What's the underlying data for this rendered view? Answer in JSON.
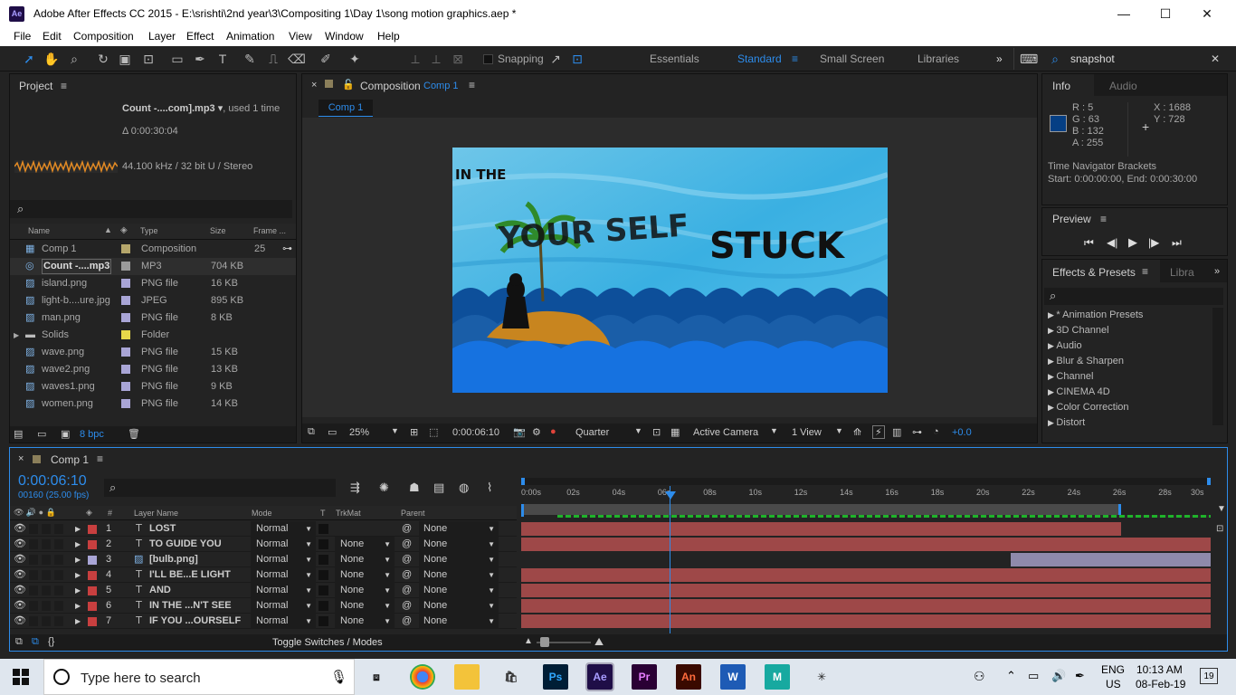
{
  "window": {
    "title": "Adobe After Effects CC 2015 - E:\\srishti\\2nd year\\3\\Compositing 1\\Day 1\\song motion graphics.aep *",
    "logo": "Ae",
    "min": "—",
    "max": "☐",
    "close": "✕"
  },
  "menu": [
    "File",
    "Edit",
    "Composition",
    "Layer",
    "Effect",
    "Animation",
    "View",
    "Window",
    "Help"
  ],
  "toolbar": {
    "snapping": "Snapping",
    "workspaces": [
      "Essentials",
      "Standard",
      "Small Screen",
      "Libraries"
    ],
    "active_workspace": "Standard",
    "search_value": "snapshot",
    "more": "»"
  },
  "project": {
    "title": "Project",
    "selected_name": "Count -....com].mp3 ▾",
    "used": ", used 1 time",
    "duration": "Δ 0:00:30:04",
    "audio_info": "44.100 kHz / 32 bit U / Stereo",
    "columns": [
      "Name",
      "Type",
      "Size",
      "Frame ..."
    ],
    "items": [
      {
        "name": "Comp 1",
        "type": "Composition",
        "size": "",
        "frame": "25",
        "color": "#b5a66b",
        "icon": "comp"
      },
      {
        "name": "Count -....mp3",
        "type": "MP3",
        "size": "704 KB",
        "frame": "",
        "color": "#9a9a9a",
        "icon": "audio"
      },
      {
        "name": "island.png",
        "type": "PNG file",
        "size": "16 KB",
        "frame": "",
        "color": "#a9a5d6",
        "icon": "image"
      },
      {
        "name": "light-b....ure.jpg",
        "type": "JPEG",
        "size": "895 KB",
        "frame": "",
        "color": "#a9a5d6",
        "icon": "image"
      },
      {
        "name": "man.png",
        "type": "PNG file",
        "size": "8 KB",
        "frame": "",
        "color": "#a9a5d6",
        "icon": "image"
      },
      {
        "name": "Solids",
        "type": "Folder",
        "size": "",
        "frame": "",
        "color": "#e6d84a",
        "icon": "folder"
      },
      {
        "name": "wave.png",
        "type": "PNG file",
        "size": "15 KB",
        "frame": "",
        "color": "#a9a5d6",
        "icon": "image"
      },
      {
        "name": "wave2.png",
        "type": "PNG file",
        "size": "13 KB",
        "frame": "",
        "color": "#a9a5d6",
        "icon": "image"
      },
      {
        "name": "waves1.png",
        "type": "PNG file",
        "size": "9 KB",
        "frame": "",
        "color": "#a9a5d6",
        "icon": "image"
      },
      {
        "name": "women.png",
        "type": "PNG file",
        "size": "14 KB",
        "frame": "",
        "color": "#a9a5d6",
        "icon": "image"
      }
    ],
    "bpc": "8 bpc"
  },
  "composition": {
    "label": "Composition",
    "name": "Comp 1",
    "tab": "Comp 1",
    "text1": "IN THE",
    "text2": "YOUR SELF",
    "text3": "STUCK",
    "zoom": "25%",
    "timecode": "0:00:06:10",
    "resolution": "Quarter",
    "camera": "Active Camera",
    "view": "1 View",
    "exposure": "+0.0"
  },
  "info": {
    "tabs": [
      "Info",
      "Audio"
    ],
    "r": "R : 5",
    "g": "G : 63",
    "b": "B : 132",
    "a": "A : 255",
    "x": "X : 1688",
    "y": "Y : 728",
    "swatch": "#053f84",
    "line1": "Time Navigator Brackets",
    "line2": "Start: 0:00:00:00, End: 0:00:30:00"
  },
  "preview": {
    "title": "Preview"
  },
  "effects": {
    "tabs": [
      "Effects & Presets",
      "Libra"
    ],
    "items": [
      "* Animation Presets",
      "3D Channel",
      "Audio",
      "Blur & Sharpen",
      "Channel",
      "CINEMA 4D",
      "Color Correction",
      "Distort"
    ]
  },
  "timeline": {
    "tab": "Comp 1",
    "timecode": "0:00:06:10",
    "fps": "00160 (25.00 fps)",
    "columns": [
      "#",
      "Layer Name",
      "Mode",
      "T",
      "TrkMat",
      "Parent"
    ],
    "ruler": [
      "0:00s",
      "02s",
      "04s",
      "06s",
      "08s",
      "10s",
      "12s",
      "14s",
      "16s",
      "18s",
      "20s",
      "22s",
      "24s",
      "26s",
      "28s",
      "30s"
    ],
    "toggle": "Toggle Switches / Modes",
    "layers": [
      {
        "num": "1",
        "name": "LOST",
        "mode": "Normal",
        "trkmat": "",
        "parent": "None",
        "color": "#c83f3f",
        "type": "text",
        "start": 0,
        "end": 0.87
      },
      {
        "num": "2",
        "name": "TO  GUIDE YOU",
        "mode": "Normal",
        "trkmat": "None",
        "parent": "None",
        "color": "#c83f3f",
        "type": "text",
        "start": 0,
        "end": 1
      },
      {
        "num": "3",
        "name": "[bulb.png]",
        "mode": "Normal",
        "trkmat": "None",
        "parent": "None",
        "color": "#a9a5d6",
        "type": "image",
        "start": 0.71,
        "end": 1
      },
      {
        "num": "4",
        "name": "I'LL BE...E LIGHT",
        "mode": "Normal",
        "trkmat": "None",
        "parent": "None",
        "color": "#c83f3f",
        "type": "text",
        "start": 0,
        "end": 1
      },
      {
        "num": "5",
        "name": "AND",
        "mode": "Normal",
        "trkmat": "None",
        "parent": "None",
        "color": "#c83f3f",
        "type": "text",
        "start": 0,
        "end": 1
      },
      {
        "num": "6",
        "name": "IN THE ...N'T  SEE",
        "mode": "Normal",
        "trkmat": "None",
        "parent": "None",
        "color": "#c83f3f",
        "type": "text",
        "start": 0,
        "end": 1
      },
      {
        "num": "7",
        "name": "IF YOU ...OURSELF",
        "mode": "Normal",
        "trkmat": "None",
        "parent": "None",
        "color": "#c83f3f",
        "type": "text",
        "start": 0,
        "end": 1
      }
    ]
  },
  "taskbar": {
    "search": "Type here to search",
    "lang1": "ENG",
    "lang2": "US",
    "time": "10:13 AM",
    "date": "08-Feb-19",
    "notif": "19"
  }
}
